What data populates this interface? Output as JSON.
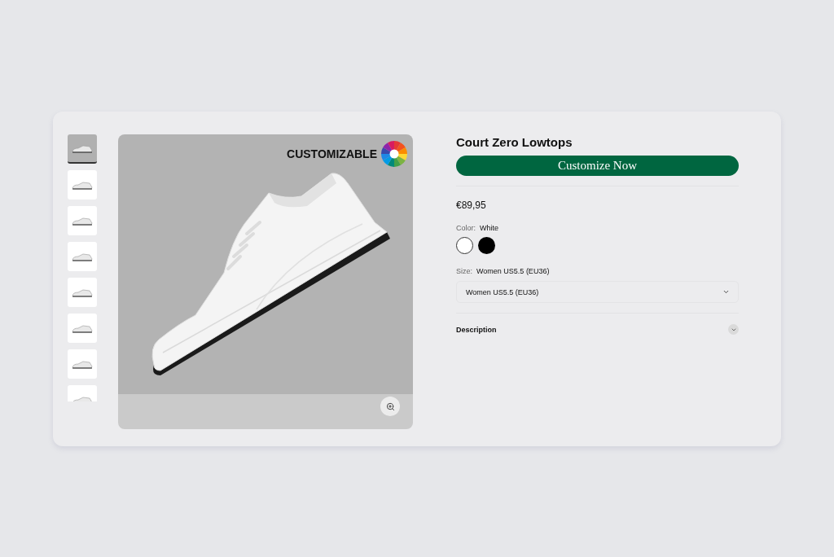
{
  "product": {
    "title": "Court Zero Lowtops",
    "badge": "CUSTOMIZABLE",
    "cta": "Customize Now",
    "price": "€89,95"
  },
  "thumbnails": [
    {
      "selected": true
    },
    {
      "selected": false
    },
    {
      "selected": false
    },
    {
      "selected": false
    },
    {
      "selected": false
    },
    {
      "selected": false
    },
    {
      "selected": false
    },
    {
      "selected": false
    }
  ],
  "color": {
    "label": "Color:",
    "value": "White",
    "swatches": [
      {
        "color": "#ffffff",
        "selected": true
      },
      {
        "color": "#000000",
        "selected": false
      }
    ]
  },
  "size": {
    "label": "Size:",
    "value": "Women US5.5 (EU36)",
    "select_value": "Women US5.5 (EU36)"
  },
  "description": {
    "label": "Description"
  }
}
